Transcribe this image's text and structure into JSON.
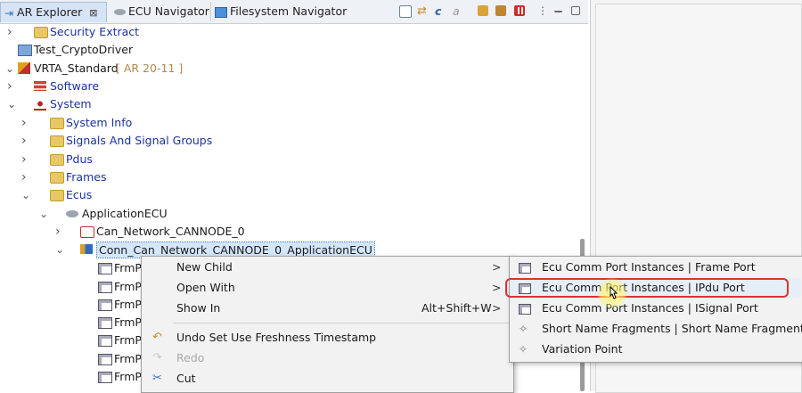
{
  "tabs": [
    {
      "label": "AR Explorer",
      "close": "⊠",
      "active": true
    },
    {
      "label": "ECU Navigator",
      "active": false
    },
    {
      "label": "Filesystem Navigator",
      "active": false
    }
  ],
  "tree": [
    {
      "label": "Security Extract",
      "indent": 1,
      "arrow": "›",
      "icon": "folder-icon",
      "style": "blue"
    },
    {
      "label": "Test_CryptoDriver",
      "indent": 0,
      "arrow": "",
      "icon": "project-icon",
      "style": "dark"
    },
    {
      "label": "VRTA_Standard",
      "suffix": "[ AR 20-11 ]",
      "indent": 0,
      "arrow": "⌄",
      "icon": "ar-project-icon",
      "style": "dark"
    },
    {
      "label": "Software",
      "indent": 1,
      "arrow": "›",
      "icon": "software-icon",
      "style": "blue"
    },
    {
      "label": "System",
      "indent": 1,
      "arrow": "⌄",
      "icon": "system-icon",
      "style": "blue"
    },
    {
      "label": "System Info",
      "indent": 2,
      "arrow": "›",
      "icon": "folder-icon",
      "style": "blue"
    },
    {
      "label": "Signals And Signal Groups",
      "indent": 2,
      "arrow": "›",
      "icon": "folder-icon",
      "style": "blue"
    },
    {
      "label": "Pdus",
      "indent": 2,
      "arrow": "›",
      "icon": "folder-icon",
      "style": "blue"
    },
    {
      "label": "Frames",
      "indent": 2,
      "arrow": "›",
      "icon": "folder-icon",
      "style": "blue"
    },
    {
      "label": "Ecus",
      "indent": 2,
      "arrow": "⌄",
      "icon": "folder-icon",
      "style": "blue"
    },
    {
      "label": "ApplicationECU",
      "indent": 3,
      "arrow": "⌄",
      "icon": "ecu-icon",
      "style": "dark"
    },
    {
      "label": "Can_Network_CANNODE_0",
      "indent": 4,
      "arrow": "›",
      "icon": "controller-icon",
      "style": "dark"
    },
    {
      "label": "Conn_Can_Network_CANNODE_0_ApplicationECU",
      "indent": 4,
      "arrow": "⌄",
      "icon": "connector-icon",
      "style": "dark",
      "selected": true
    },
    {
      "label": "FrmP",
      "indent": 5,
      "arrow": "",
      "icon": "port-icon",
      "style": "dark"
    },
    {
      "label": "FrmP",
      "indent": 5,
      "arrow": "",
      "icon": "port-icon",
      "style": "dark"
    },
    {
      "label": "FrmP",
      "indent": 5,
      "arrow": "",
      "icon": "port-icon",
      "style": "dark"
    },
    {
      "label": "FrmP",
      "indent": 5,
      "arrow": "",
      "icon": "port-icon",
      "style": "dark"
    },
    {
      "label": "FrmP",
      "indent": 5,
      "arrow": "",
      "icon": "port-icon",
      "style": "dark"
    },
    {
      "label": "FrmP",
      "indent": 5,
      "arrow": "",
      "icon": "port-icon",
      "style": "dark"
    },
    {
      "label": "FrmP",
      "indent": 5,
      "arrow": "",
      "icon": "port-icon",
      "style": "dark"
    }
  ],
  "context_menu": {
    "items": [
      {
        "label": "New Child",
        "shortcut": "",
        "submenu": ">",
        "icon": "",
        "enabled": true
      },
      {
        "label": "Open With",
        "shortcut": "",
        "submenu": ">",
        "icon": "",
        "enabled": true
      },
      {
        "label": "Show In",
        "shortcut": "Alt+Shift+W",
        "submenu": ">",
        "icon": "",
        "enabled": true
      },
      {
        "label": "Undo Set Use Freshness Timestamp",
        "shortcut": "",
        "submenu": "",
        "icon": "undo-icon",
        "enabled": true
      },
      {
        "label": "Redo",
        "shortcut": "",
        "submenu": "",
        "icon": "redo-icon",
        "enabled": false
      },
      {
        "label": "Cut",
        "shortcut": "",
        "submenu": "",
        "icon": "cut-icon",
        "enabled": true
      }
    ]
  },
  "submenu": {
    "items": [
      {
        "label": "Ecu Comm Port Instances | Frame Port",
        "icon": "port-icon"
      },
      {
        "label": "Ecu Comm Port Instances | IPdu Port",
        "icon": "port-icon",
        "highlighted": true
      },
      {
        "label": "Ecu Comm Port Instances | ISignal Port",
        "icon": "port-icon"
      },
      {
        "label": "Short Name Fragments | Short Name Fragment",
        "icon": "diamond-icon"
      },
      {
        "label": "Variation Point",
        "icon": "diamond-icon"
      }
    ]
  },
  "colors": {
    "highlight_border": "#e03030",
    "tree_label": "#1a33a0",
    "version_label": "#b08a4a"
  }
}
